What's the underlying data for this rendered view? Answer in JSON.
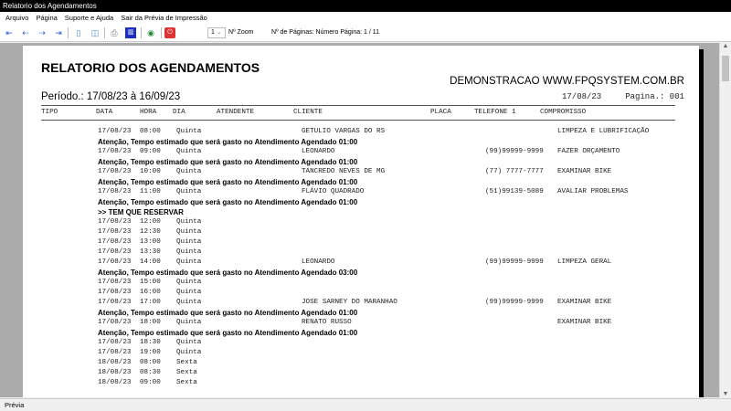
{
  "window": {
    "title": "Relatorio dos Agendamentos"
  },
  "menu": [
    "Arquivo",
    "Página",
    "Suporte e Ajuda",
    "Sair da Prévia de Impressão"
  ],
  "toolbar": {
    "page_select": "1",
    "zoom_label": "Nº Zoom",
    "pages_label": "Nº de Páginas: Número Página: 1 / 11"
  },
  "report": {
    "title": "RELATORIO DOS AGENDAMENTOS",
    "company": "DEMONSTRACAO WWW.FPQSYSTEM.COM.BR",
    "period": "Período.: 17/08/23 à 16/09/23",
    "print_date": "17/08/23",
    "page_label": "Pagina.: 001",
    "columns": [
      "TIPO",
      "DATA",
      "HORA",
      "DIA",
      "ATENDENTE",
      "CLIENTE",
      "PLACA",
      "TELEFONE 1",
      "COMPROMISSO"
    ],
    "rows": [
      {
        "kind": "rec",
        "date": "17/08/23",
        "time": "08:00",
        "day": "Quinta",
        "client": "GETULIO VARGAS DO RS",
        "phone": "",
        "task": "LIMPEZA E LUBRIFICAÇÃO"
      },
      {
        "kind": "note",
        "text": "Atenção, Tempo estimado que será gasto no Atendimento Agendado  01:00"
      },
      {
        "kind": "rec",
        "date": "17/08/23",
        "time": "09:00",
        "day": "Quinta",
        "client": "LEONARDO",
        "phone": "(99)99999-9999",
        "task": "FAZER ORÇAMENTO"
      },
      {
        "kind": "note",
        "text": "Atenção, Tempo estimado que será gasto no Atendimento Agendado  01:00"
      },
      {
        "kind": "rec",
        "date": "17/08/23",
        "time": "10:00",
        "day": "Quinta",
        "client": "TANCREDO NEVES DE MG",
        "phone": "(77) 7777-7777",
        "task": "EXAMINAR BIKE"
      },
      {
        "kind": "note",
        "text": "Atenção, Tempo estimado que será gasto no Atendimento Agendado  01:00"
      },
      {
        "kind": "rec",
        "date": "17/08/23",
        "time": "11:00",
        "day": "Quinta",
        "client": "FLÁVIO QUADRADO",
        "phone": "(51)99139-5089",
        "task": "AVALIAR PROBLEMAS"
      },
      {
        "kind": "note",
        "text": "Atenção, Tempo estimado que será gasto no Atendimento Agendado  01:00"
      },
      {
        "kind": "note",
        "text": ">> TEM QUE RESERVAR"
      },
      {
        "kind": "rec",
        "date": "17/08/23",
        "time": "12:00",
        "day": "Quinta",
        "client": "",
        "phone": "",
        "task": ""
      },
      {
        "kind": "rec",
        "date": "17/08/23",
        "time": "12:30",
        "day": "Quinta",
        "client": "",
        "phone": "",
        "task": ""
      },
      {
        "kind": "rec",
        "date": "17/08/23",
        "time": "13:00",
        "day": "Quinta",
        "client": "",
        "phone": "",
        "task": ""
      },
      {
        "kind": "rec",
        "date": "17/08/23",
        "time": "13:30",
        "day": "Quinta",
        "client": "",
        "phone": "",
        "task": ""
      },
      {
        "kind": "rec",
        "date": "17/08/23",
        "time": "14:00",
        "day": "Quinta",
        "client": "LEONARDO",
        "phone": "(99)99999-9999",
        "task": "LIMPEZA GERAL"
      },
      {
        "kind": "note",
        "text": "Atenção, Tempo estimado que será gasto no Atendimento Agendado  03:00"
      },
      {
        "kind": "rec",
        "date": "17/08/23",
        "time": "15:00",
        "day": "Quinta",
        "client": "",
        "phone": "",
        "task": ""
      },
      {
        "kind": "rec",
        "date": "17/08/23",
        "time": "16:00",
        "day": "Quinta",
        "client": "",
        "phone": "",
        "task": ""
      },
      {
        "kind": "rec",
        "date": "17/08/23",
        "time": "17:00",
        "day": "Quinta",
        "client": "JOSE SARNEY DO MARANHAO",
        "phone": "(99)99999-9999",
        "task": "EXAMINAR BIKE"
      },
      {
        "kind": "note",
        "text": "Atenção, Tempo estimado que será gasto no Atendimento Agendado  01:00"
      },
      {
        "kind": "rec",
        "date": "17/08/23",
        "time": "18:00",
        "day": "Quinta",
        "client": "RENATO RUSSO",
        "phone": "",
        "task": "EXAMINAR BIKE"
      },
      {
        "kind": "note",
        "text": "Atenção, Tempo estimado que será gasto no Atendimento Agendado  01:00"
      },
      {
        "kind": "rec",
        "date": "17/08/23",
        "time": "18:30",
        "day": "Quinta",
        "client": "",
        "phone": "",
        "task": ""
      },
      {
        "kind": "rec",
        "date": "17/08/23",
        "time": "19:00",
        "day": "Quinta",
        "client": "",
        "phone": "",
        "task": ""
      },
      {
        "kind": "rec",
        "date": "18/08/23",
        "time": "08:00",
        "day": "Sexta",
        "client": "",
        "phone": "",
        "task": ""
      },
      {
        "kind": "rec",
        "date": "18/08/23",
        "time": "08:30",
        "day": "Sexta",
        "client": "",
        "phone": "",
        "task": ""
      },
      {
        "kind": "rec",
        "date": "18/08/23",
        "time": "09:00",
        "day": "Sexta",
        "client": "",
        "phone": "",
        "task": ""
      }
    ]
  },
  "status": "Prévia"
}
